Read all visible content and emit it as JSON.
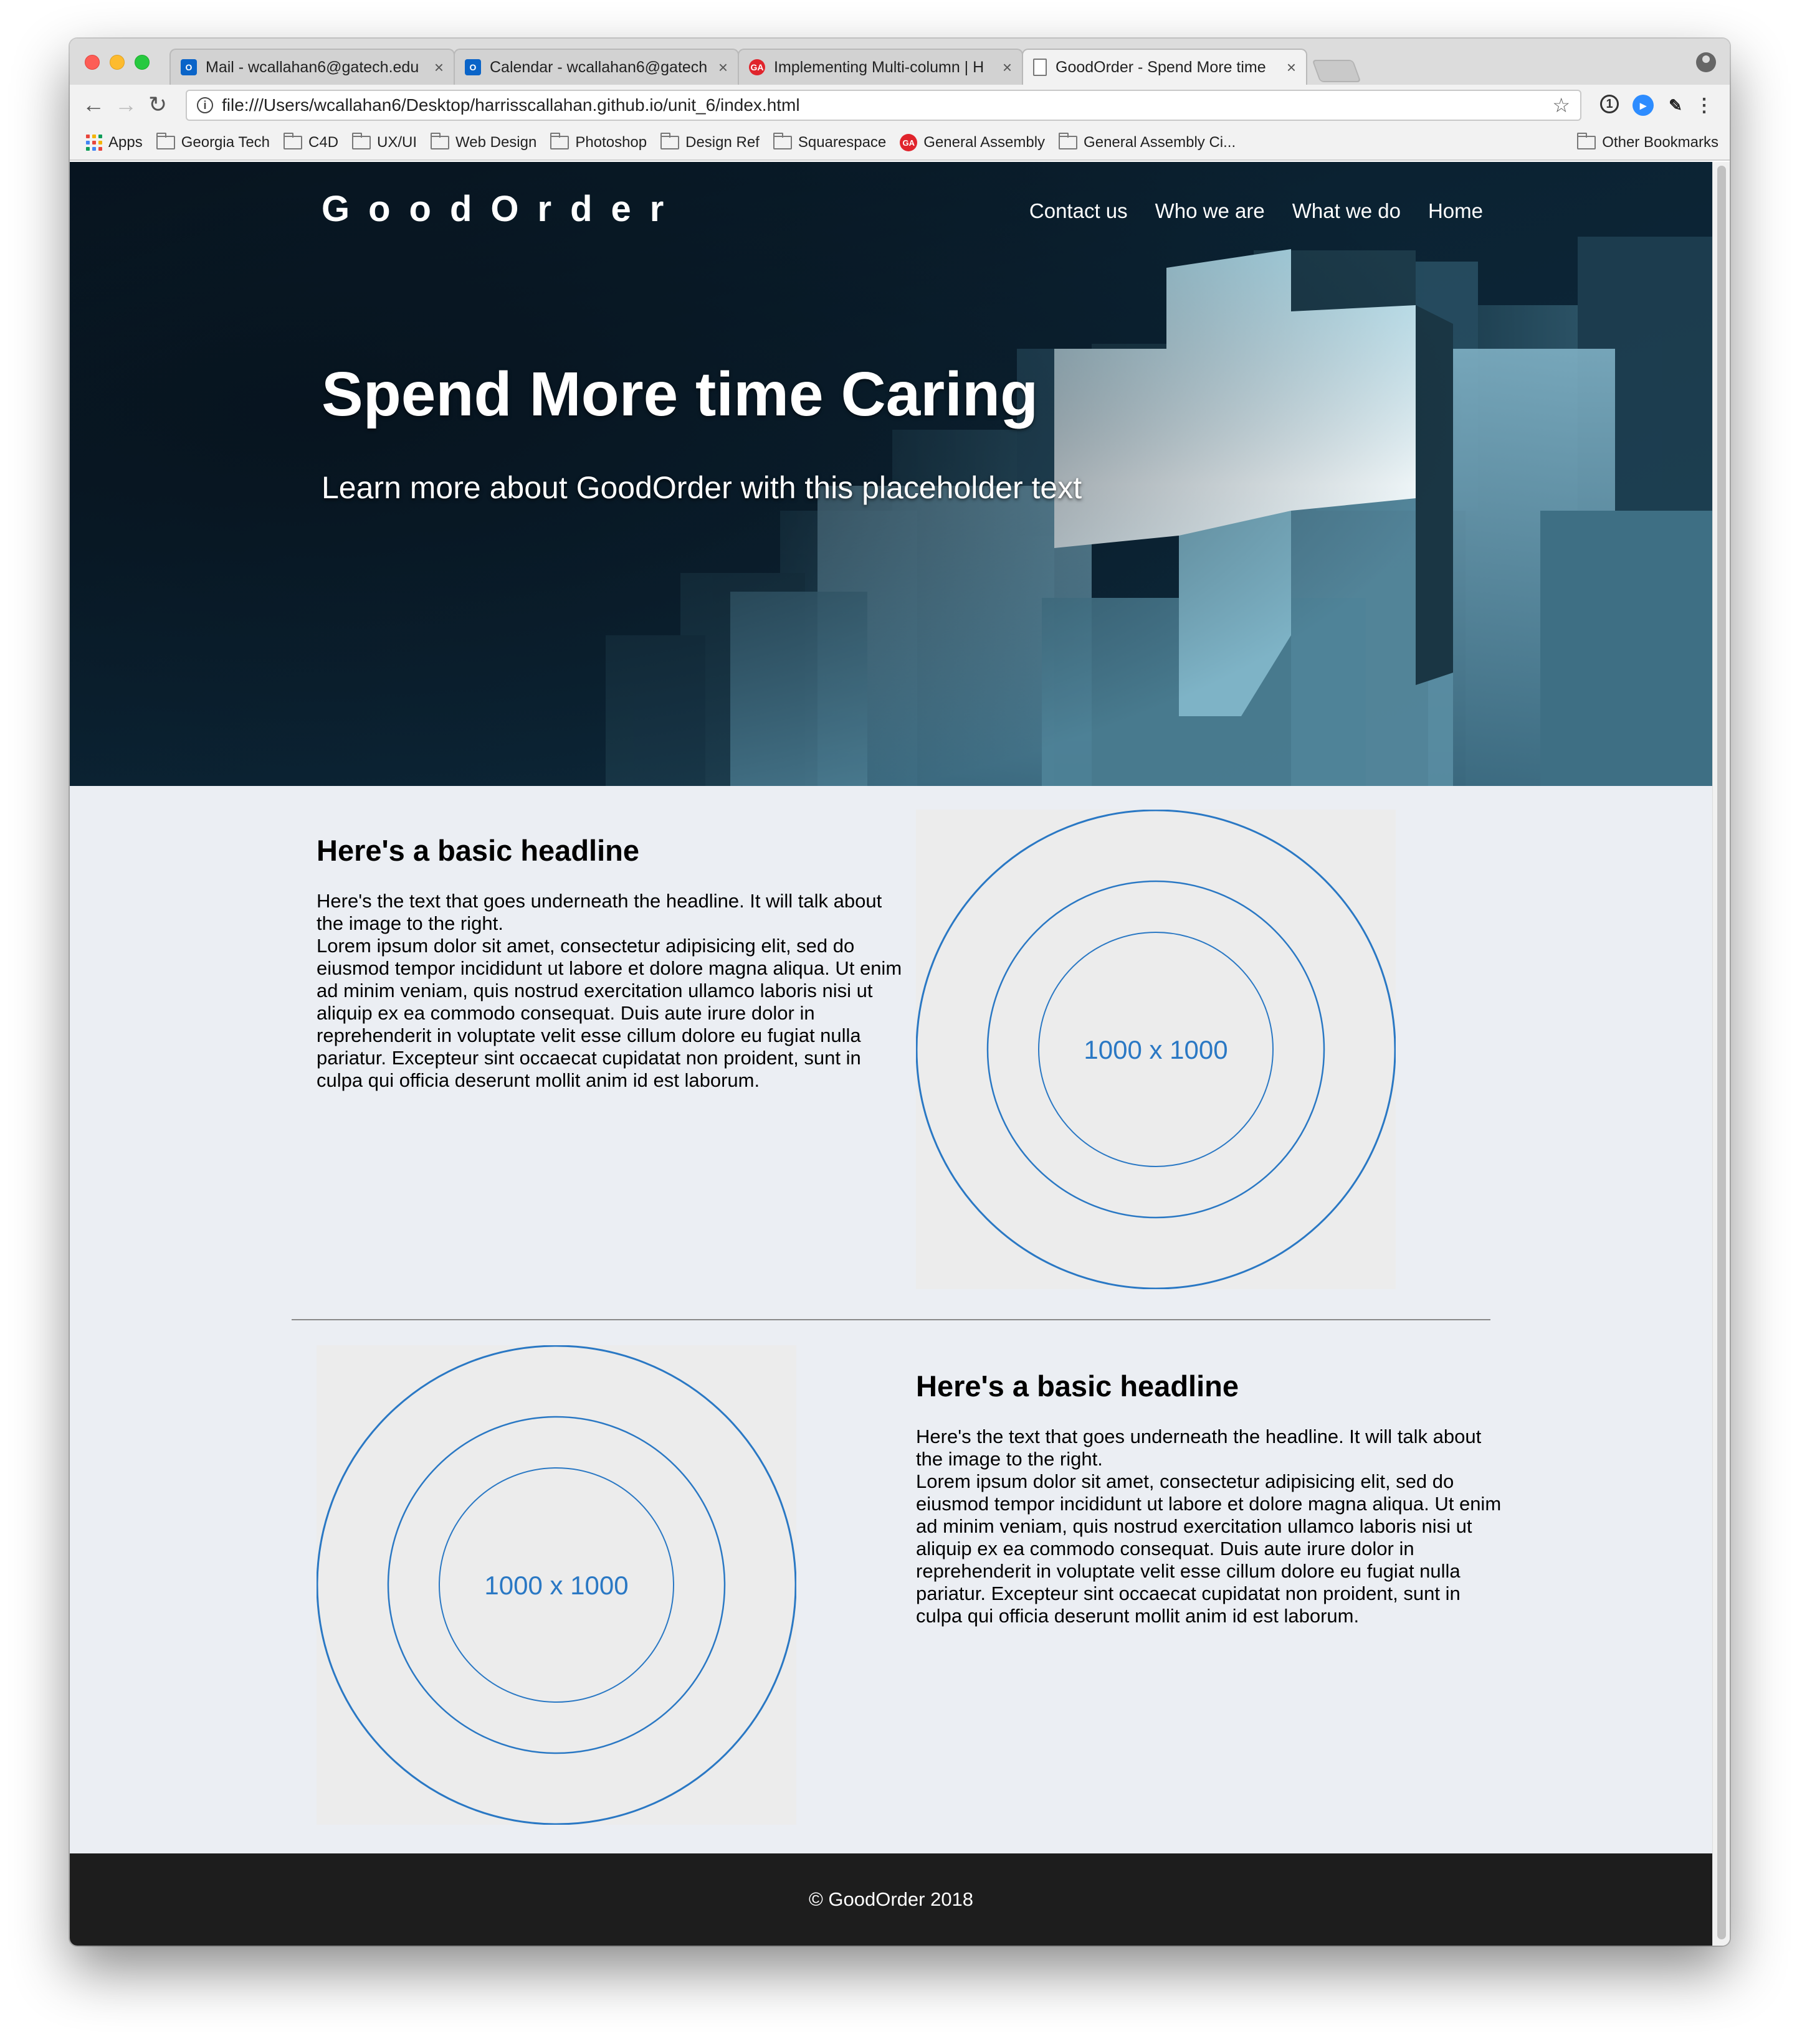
{
  "browser": {
    "tabs": [
      {
        "title": "Mail - wcallahan6@gatech.edu",
        "favicon": "outlook-icon",
        "active": false
      },
      {
        "title": "Calendar - wcallahan6@gatech",
        "favicon": "outlook-icon",
        "active": false
      },
      {
        "title": "Implementing Multi-column | H",
        "favicon": "ga-icon",
        "active": false
      },
      {
        "title": "GoodOrder - Spend More time",
        "favicon": "page-icon",
        "active": true
      }
    ],
    "close_glyph": "×",
    "url": "file:///Users/wcallahan6/Desktop/harrisscallahan.github.io/unit_6/index.html",
    "bookmarks": [
      {
        "label": "Apps",
        "icon": "apps-grid-icon"
      },
      {
        "label": "Georgia Tech",
        "icon": "folder-icon"
      },
      {
        "label": "C4D",
        "icon": "folder-icon"
      },
      {
        "label": "UX/UI",
        "icon": "folder-icon"
      },
      {
        "label": "Web Design",
        "icon": "folder-icon"
      },
      {
        "label": "Photoshop",
        "icon": "folder-icon"
      },
      {
        "label": "Design Ref",
        "icon": "folder-icon"
      },
      {
        "label": "Squarespace",
        "icon": "folder-icon"
      },
      {
        "label": "General Assembly",
        "icon": "ga-icon"
      },
      {
        "label": "General Assembly Ci...",
        "icon": "folder-icon"
      }
    ],
    "other_bookmarks": "Other Bookmarks"
  },
  "site": {
    "logo": "GoodOrder",
    "nav": [
      "Contact us",
      "Who we are",
      "What we do",
      "Home"
    ],
    "hero": {
      "title": "Spend More time Caring",
      "subtitle": "Learn more about GoodOrder with this placeholder text"
    },
    "sections": [
      {
        "headline": "Here's a basic headline",
        "intro": "Here's the text that goes underneath the headline. It will talk about the image to the right.",
        "body": "Lorem ipsum dolor sit amet, consectetur adipisicing elit, sed do eiusmod tempor incididunt ut labore et dolore magna aliqua. Ut enim ad minim veniam, quis nostrud exercitation ullamco laboris nisi ut aliquip ex ea commodo consequat. Duis aute irure dolor in reprehenderit in voluptate velit esse cillum dolore eu fugiat nulla pariatur. Excepteur sint occaecat cupidatat non proident, sunt in culpa qui officia deserunt mollit anim id est laborum.",
        "image_label": "1000 x 1000"
      },
      {
        "headline": "Here's a basic headline",
        "intro": "Here's the text that goes underneath the headline. It will talk about the image to the right.",
        "body": "Lorem ipsum dolor sit amet, consectetur adipisicing elit, sed do eiusmod tempor incididunt ut labore et dolore magna aliqua. Ut enim ad minim veniam, quis nostrud exercitation ullamco laboris nisi ut aliquip ex ea commodo consequat. Duis aute irure dolor in reprehenderit in voluptate velit esse cillum dolore eu fugiat nulla pariatur. Excepteur sint occaecat cupidatat non proident, sunt in culpa qui officia deserunt mollit anim id est laborum.",
        "image_label": "1000 x 1000"
      }
    ],
    "footer": "© GoodOrder 2018"
  },
  "colors": {
    "accent_blue": "#2a78c4",
    "hero_dark": "#07141f",
    "page_bg": "#ebeef3",
    "footer_bg": "#1d1d1d",
    "placeholder_bg": "#ececec"
  }
}
